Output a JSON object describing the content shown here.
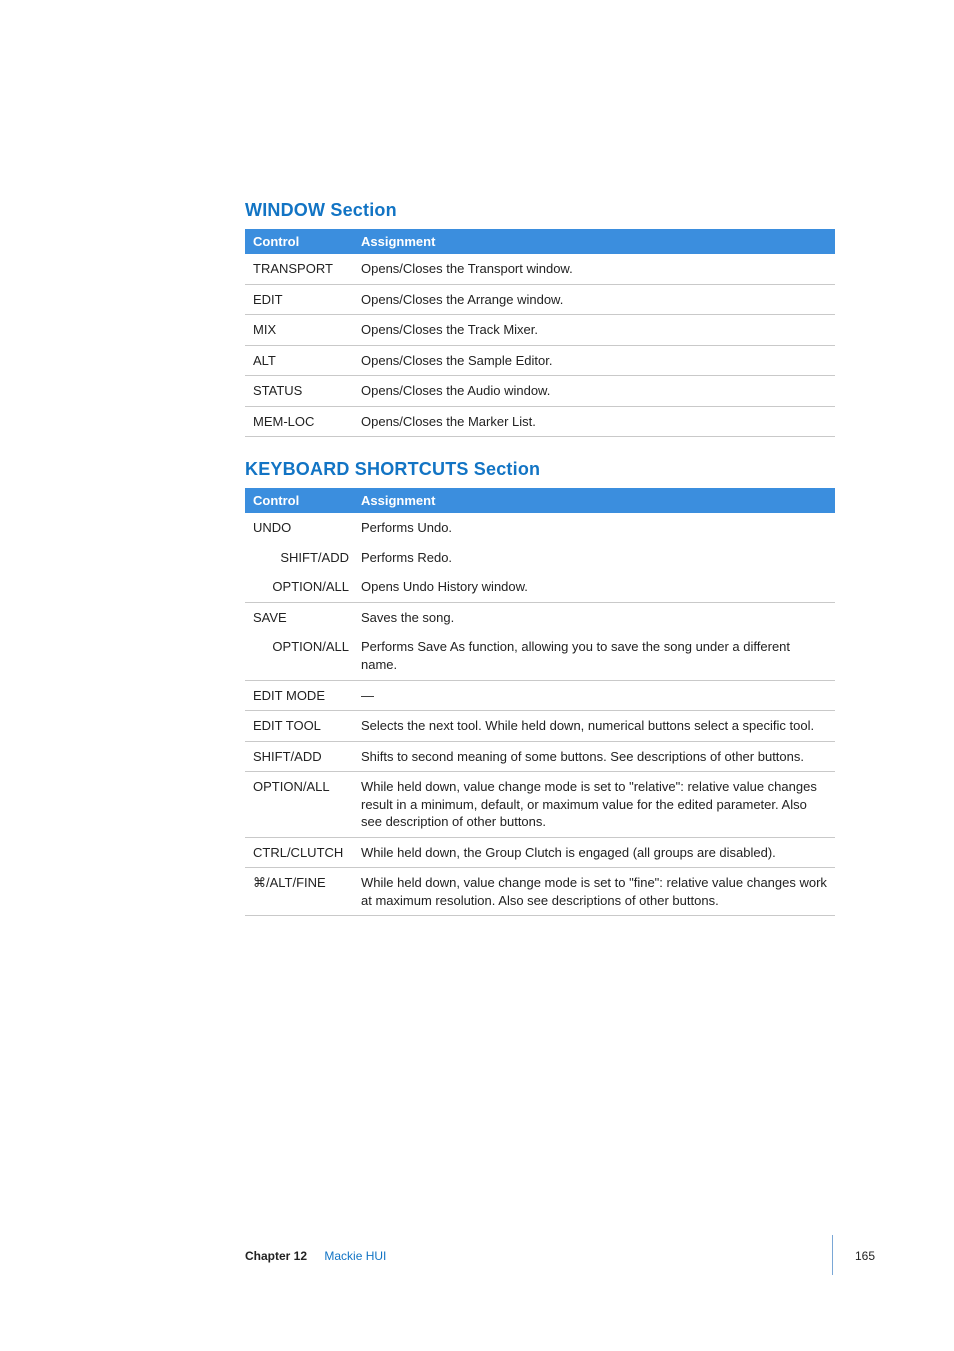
{
  "sections": [
    {
      "title": "WINDOW Section",
      "headers": {
        "control": "Control",
        "assignment": "Assignment"
      },
      "rows": [
        {
          "control": "TRANSPORT",
          "sub": false,
          "assignment": "Opens/Closes the Transport window."
        },
        {
          "control": "EDIT",
          "sub": false,
          "assignment": "Opens/Closes the Arrange window."
        },
        {
          "control": "MIX",
          "sub": false,
          "assignment": "Opens/Closes the Track Mixer."
        },
        {
          "control": "ALT",
          "sub": false,
          "assignment": "Opens/Closes the Sample Editor."
        },
        {
          "control": "STATUS",
          "sub": false,
          "assignment": "Opens/Closes the Audio window."
        },
        {
          "control": "MEM-LOC",
          "sub": false,
          "assignment": "Opens/Closes the Marker List."
        }
      ]
    },
    {
      "title": "KEYBOARD SHORTCUTS Section",
      "headers": {
        "control": "Control",
        "assignment": "Assignment"
      },
      "rows": [
        {
          "control": "UNDO",
          "sub": false,
          "assignment": "Performs Undo.",
          "noborder": true
        },
        {
          "control": "SHIFT/ADD",
          "sub": true,
          "assignment": "Performs Redo.",
          "noborder": true
        },
        {
          "control": "OPTION/ALL",
          "sub": true,
          "assignment": "Opens Undo History window."
        },
        {
          "control": "SAVE",
          "sub": false,
          "assignment": "Saves the song.",
          "noborder": true
        },
        {
          "control": "OPTION/ALL",
          "sub": true,
          "assignment": "Performs Save As function, allowing you to save the song under a different name."
        },
        {
          "control": "EDIT MODE",
          "sub": false,
          "assignment": "—"
        },
        {
          "control": "EDIT TOOL",
          "sub": false,
          "assignment": "Selects the next tool. While held down, numerical buttons select a specific tool."
        },
        {
          "control": "SHIFT/ADD",
          "sub": false,
          "assignment": "Shifts to second meaning of some buttons. See descriptions of other buttons."
        },
        {
          "control": "OPTION/ALL",
          "sub": false,
          "assignment": "While held down, value change mode is set to \"relative\":  relative value changes result in a minimum, default, or maximum value for the edited parameter. Also see description of other buttons."
        },
        {
          "control": "CTRL/CLUTCH",
          "sub": false,
          "assignment": "While held down, the Group Clutch is engaged (all groups are disabled)."
        },
        {
          "control": "⌘/ALT/FINE",
          "sub": false,
          "assignment": "While held down, value change mode is set to \"fine\":  relative value changes work at maximum resolution. Also see descriptions of other buttons."
        }
      ]
    }
  ],
  "footer": {
    "chapter_label": "Chapter 12",
    "chapter_name": "Mackie HUI",
    "page_number": "165"
  }
}
